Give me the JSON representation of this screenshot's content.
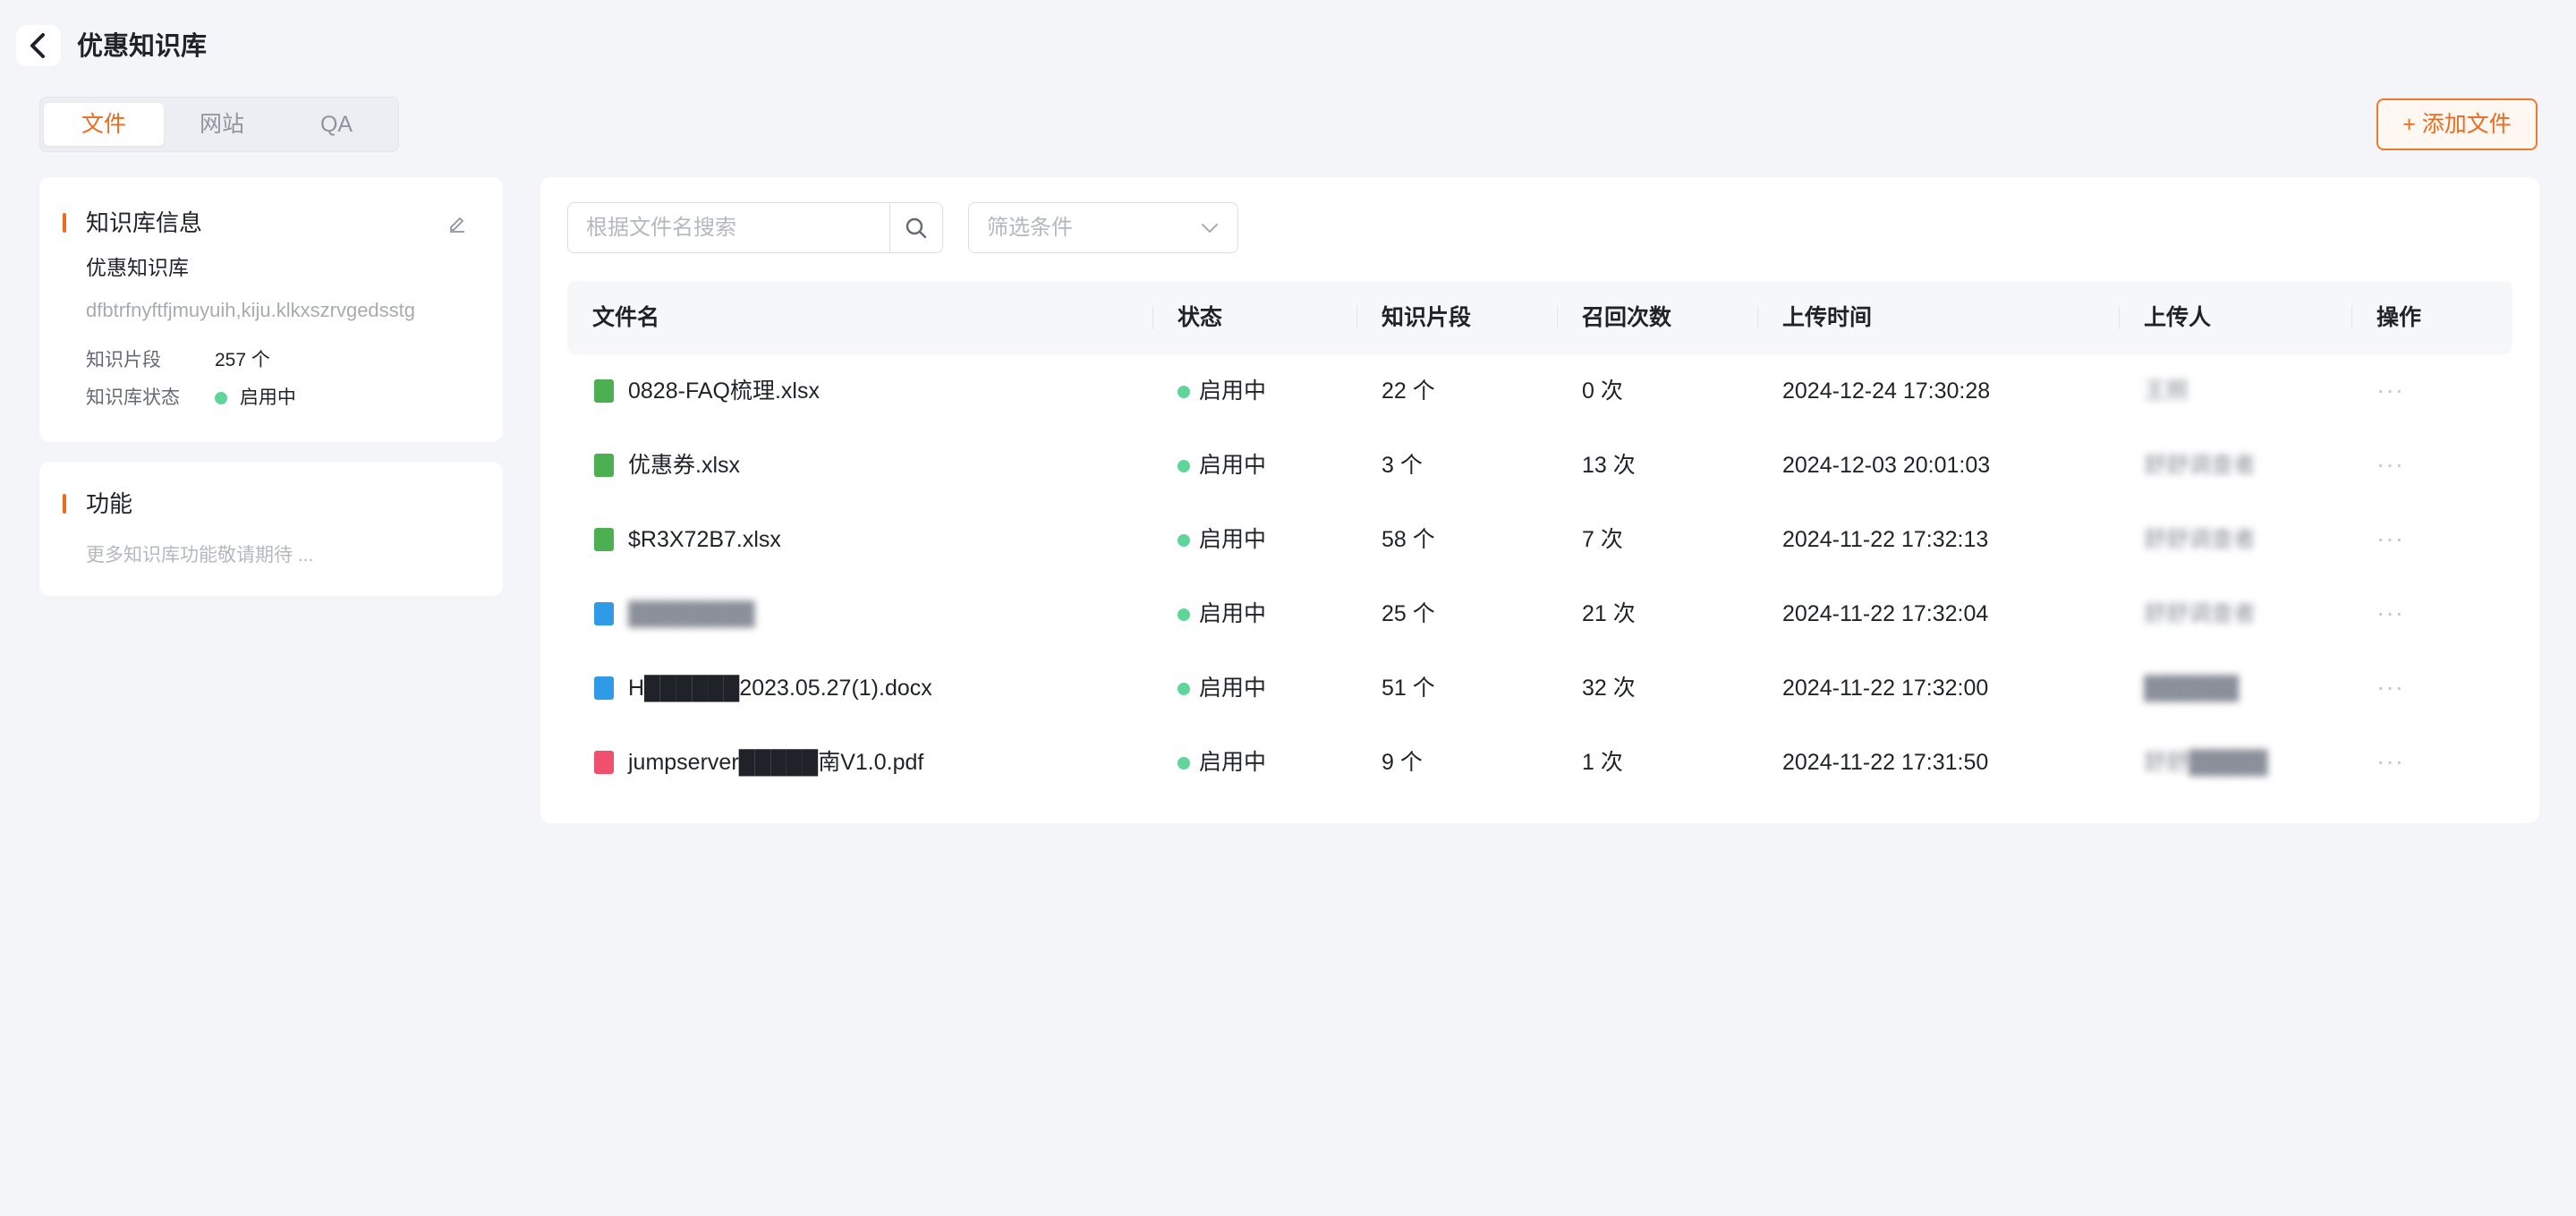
{
  "header": {
    "title": "优惠知识库"
  },
  "tabs": [
    {
      "label": "文件",
      "active": true
    },
    {
      "label": "网站",
      "active": false
    },
    {
      "label": "QA",
      "active": false
    }
  ],
  "actions": {
    "add_file": "+ 添加文件"
  },
  "info_card": {
    "title": "知识库信息",
    "name": "优惠知识库",
    "description": "dfbtrfnyftfjmuyuih,kiju.klkxszrvgedsstg",
    "fragments_label": "知识片段",
    "fragments_value": "257 个",
    "status_label": "知识库状态",
    "status_value": "启用中"
  },
  "feature_card": {
    "title": "功能",
    "placeholder": "更多知识库功能敬请期待 ..."
  },
  "search": {
    "placeholder": "根据文件名搜索"
  },
  "filter": {
    "placeholder": "筛选条件"
  },
  "table": {
    "columns": [
      "文件名",
      "状态",
      "知识片段",
      "召回次数",
      "上传时间",
      "上传人",
      "操作"
    ],
    "rows": [
      {
        "name": "0828-FAQ梳理.xlsx",
        "type": "xlsx",
        "status": "启用中",
        "fragments": "22 个",
        "recalls": "0 次",
        "time": "2024-12-24 17:30:28",
        "uploader": "王照"
      },
      {
        "name": "优惠券.xlsx",
        "type": "xlsx",
        "status": "启用中",
        "fragments": "3 个",
        "recalls": "13 次",
        "time": "2024-12-03 20:01:03",
        "uploader": "舒舒调查者"
      },
      {
        "name": "$R3X72B7.xlsx",
        "type": "xlsx",
        "status": "启用中",
        "fragments": "58 个",
        "recalls": "7 次",
        "time": "2024-11-22 17:32:13",
        "uploader": "舒舒调查者"
      },
      {
        "name": "████████",
        "type": "docx",
        "status": "启用中",
        "fragments": "25 个",
        "recalls": "21 次",
        "time": "2024-11-22 17:32:04",
        "uploader": "舒舒调查者"
      },
      {
        "name": "H██████2023.05.27(1).docx",
        "type": "docx",
        "status": "启用中",
        "fragments": "51 个",
        "recalls": "32 次",
        "time": "2024-11-22 17:32:00",
        "uploader": "██████"
      },
      {
        "name": "jumpserver█████南V1.0.pdf",
        "type": "pdf",
        "status": "启用中",
        "fragments": "9 个",
        "recalls": "1 次",
        "time": "2024-11-22 17:31:50",
        "uploader": "舒舒█████"
      }
    ],
    "more_label": "···"
  },
  "colors": {
    "accent": "#ee6b1c",
    "status_green": "#5fd59a",
    "xlsx_icon": "#4caf50",
    "docx_icon": "#2f9be6",
    "pdf_icon": "#f0506e"
  }
}
